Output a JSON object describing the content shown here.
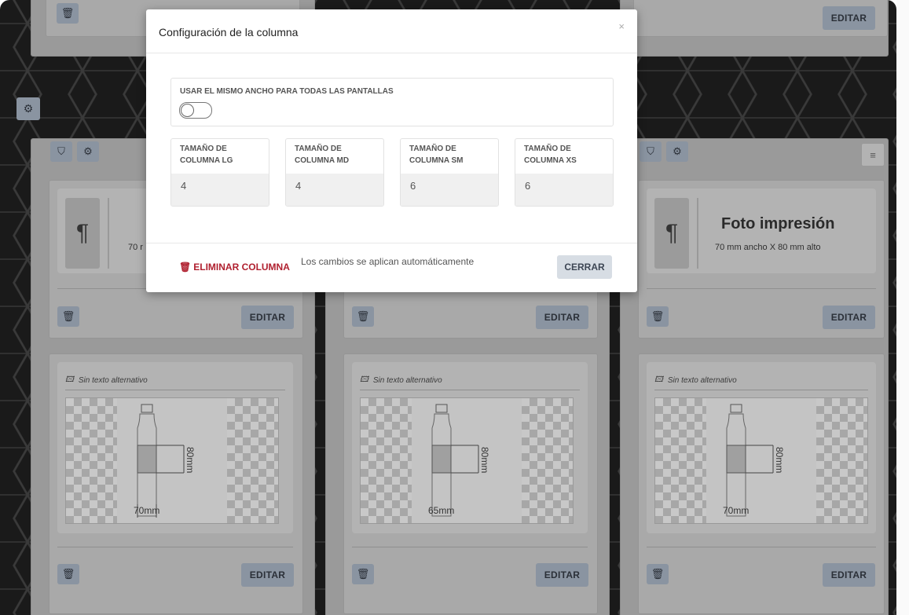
{
  "editor": {
    "edit_label": "EDITAR",
    "foto_title": "Foto impresión",
    "foto_sub_left": "70 r",
    "foto_sub_right": "70 mm ancho X 80 mm alto",
    "alt_text": "Sin texto alternativo",
    "columns": [
      {
        "width_label": "70mm",
        "height_label": "80mm"
      },
      {
        "width_label": "65mm",
        "height_label": "80mm"
      },
      {
        "width_label": "70mm",
        "height_label": "80mm"
      }
    ],
    "icons": {
      "delete": "trash-icon",
      "settings": "gear-icon",
      "style": "paint-bucket-icon",
      "paragraph": "pilcrow-icon",
      "image": "image-icon",
      "menu": "hamburger-icon"
    }
  },
  "modal": {
    "title": "Configuración de la columna",
    "close_symbol": "×",
    "same_width_label": "USAR EL MISMO ANCHO PARA TODAS LAS PANTALLAS",
    "same_width_enabled": false,
    "sizes": [
      {
        "label": "TAMAÑO DE COLUMNA LG",
        "value": "4"
      },
      {
        "label": "TAMAÑO DE COLUMNA MD",
        "value": "4"
      },
      {
        "label": "TAMAÑO DE COLUMNA SM",
        "value": "6"
      },
      {
        "label": "TAMAÑO DE COLUMNA XS",
        "value": "6"
      }
    ],
    "delete_label": "ELIMINAR COLUMNA",
    "note": "Los cambios se aplican automáticamente",
    "close_label": "CERRAR"
  },
  "colors": {
    "danger": "#b0202f",
    "button": "#d7dde4",
    "overlay_button": "#8a94a1"
  }
}
